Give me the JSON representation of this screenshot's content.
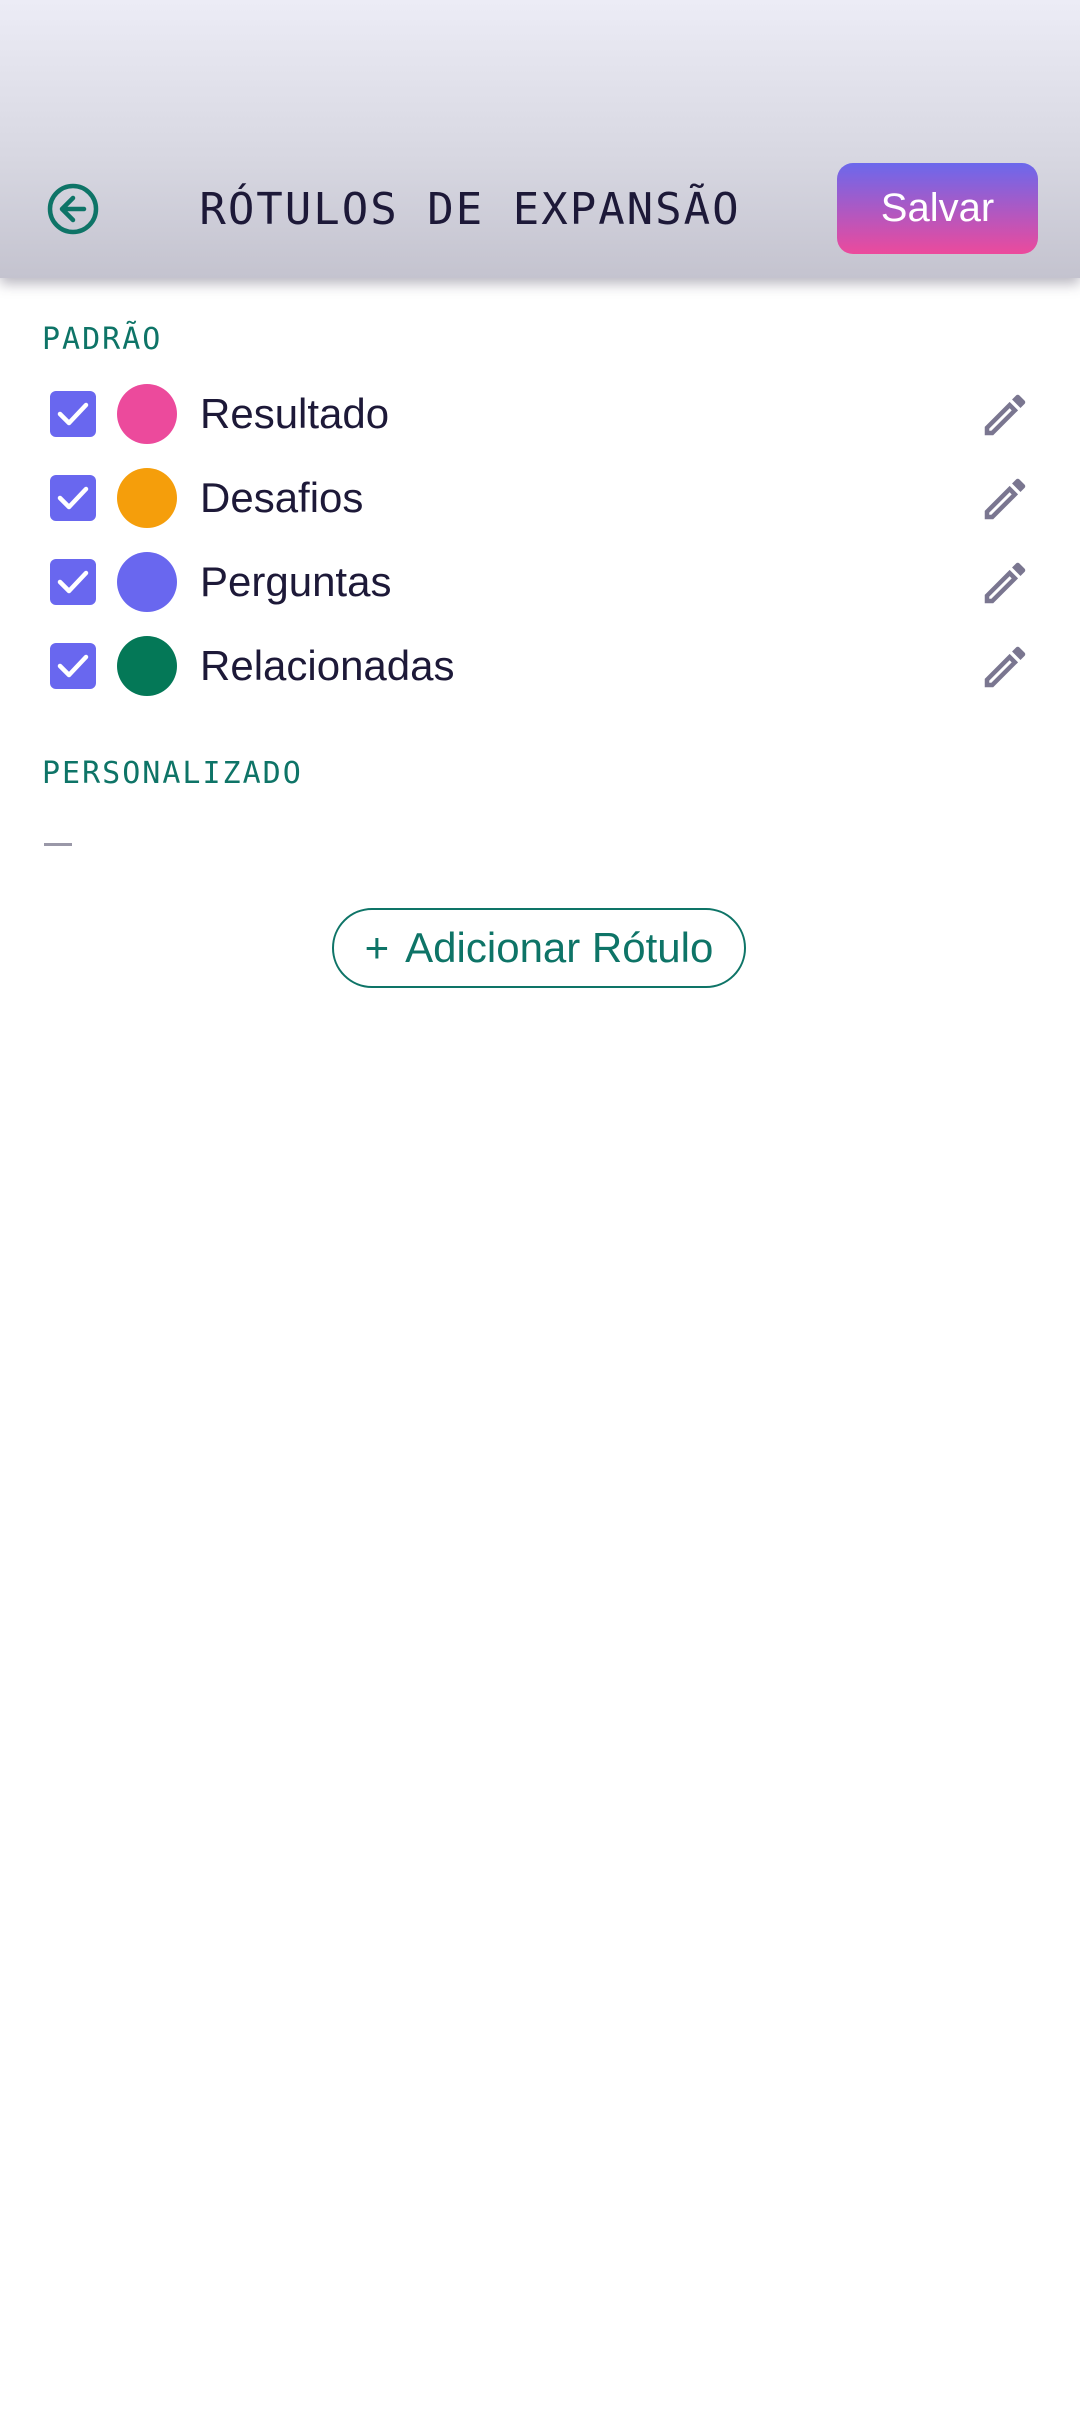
{
  "header": {
    "title": "RÓTULOS DE EXPANSÃO",
    "save_label": "Salvar",
    "back_icon": "arrow-left-circle-icon"
  },
  "sections": {
    "default": {
      "label": "PADRÃO",
      "items": [
        {
          "label": "Resultado",
          "color": "#ec4a9c",
          "checked": true
        },
        {
          "label": "Desafios",
          "color": "#f59e0b",
          "checked": true
        },
        {
          "label": "Perguntas",
          "color": "#6967ef",
          "checked": true
        },
        {
          "label": "Relacionadas",
          "color": "#047857",
          "checked": true
        }
      ]
    },
    "custom": {
      "label": "PERSONALIZADO",
      "empty_text": "—"
    }
  },
  "add_button": {
    "icon": "+",
    "label": "Adicionar Rótulo"
  },
  "colors": {
    "accent": "#0e7467",
    "checkbox": "#6967ef",
    "save_gradient_top": "#6b68ec",
    "save_gradient_bottom": "#ec4a9c",
    "edit_icon": "#7a7690"
  }
}
